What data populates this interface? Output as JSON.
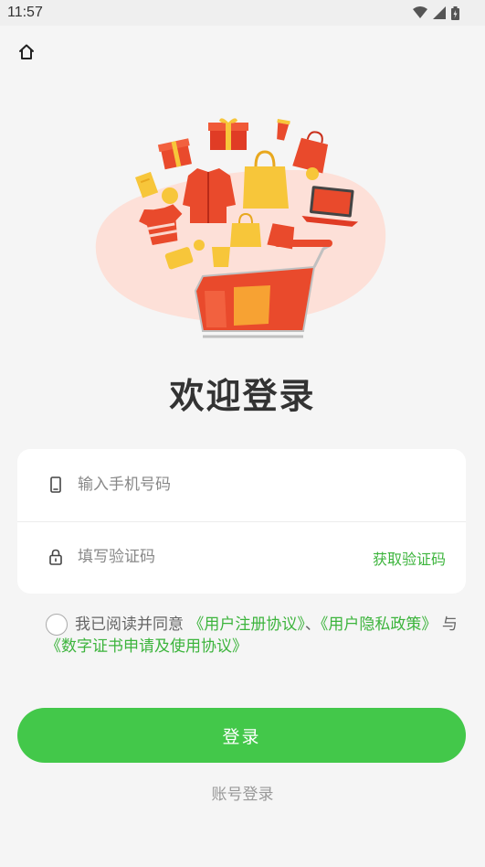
{
  "status_bar": {
    "time": "11:57"
  },
  "title": "欢迎登录",
  "form": {
    "phone_placeholder": "输入手机号码",
    "code_placeholder": "填写验证码",
    "get_code_label": "获取验证码"
  },
  "agreement": {
    "prefix": "我已阅读并同意",
    "user_agreement": "《用户注册协议》",
    "sep1": "、",
    "privacy_policy": "《用户隐私政策》",
    "sep2": "与",
    "cert_agreement": "《数字证书申请及使用协议》"
  },
  "login_button_label": "登录",
  "account_login_label": "账号登录",
  "colors": {
    "accent": "#43c84a",
    "link": "#3cb43c",
    "background": "#f5f5f5"
  }
}
